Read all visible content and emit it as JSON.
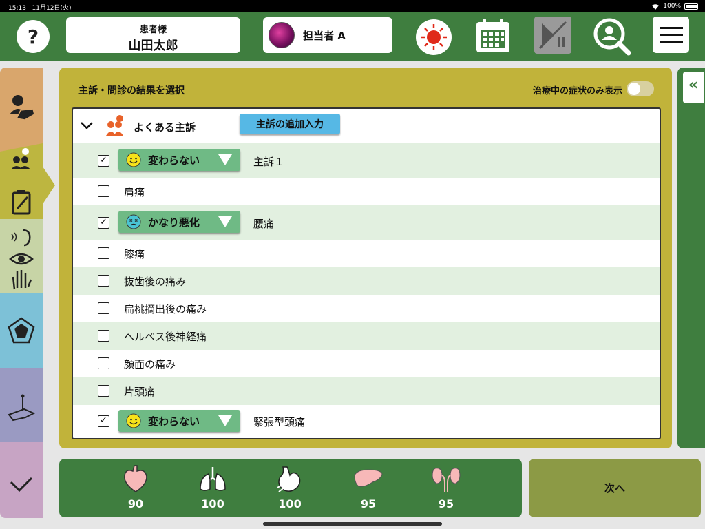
{
  "status_bar": {
    "time": "15:13",
    "date": "11月12日(火)",
    "battery": "100%"
  },
  "header": {
    "help_label": "?",
    "patient_label": "患者様",
    "patient_name": "山田太郎",
    "staff_name": "担当者 A"
  },
  "panel": {
    "title": "主訴・問診の結果を選択",
    "toggle_label": "治療中の症状のみ表示",
    "toggle_on": false,
    "section_title": "よくある主訴",
    "add_button": "主訴の追加入力"
  },
  "rows": [
    {
      "label": "主訴１",
      "checked": true,
      "status": "変わらない",
      "face": "smile-icon"
    },
    {
      "label": "肩痛",
      "checked": false
    },
    {
      "label": "腰痛",
      "checked": true,
      "status": "かなり悪化",
      "face": "dizzy-face-icon"
    },
    {
      "label": "膝痛",
      "checked": false
    },
    {
      "label": "抜歯後の痛み",
      "checked": false
    },
    {
      "label": "扁桃摘出後の痛み",
      "checked": false
    },
    {
      "label": "ヘルペス後神経痛",
      "checked": false
    },
    {
      "label": "顔面の痛み",
      "checked": false
    },
    {
      "label": "片頭痛",
      "checked": false
    },
    {
      "label": "緊張型頭痛",
      "checked": true,
      "status": "変わらない",
      "face": "smile-icon"
    }
  ],
  "right_tab_label": "«",
  "metrics": [
    {
      "icon": "heart-icon",
      "value": "90"
    },
    {
      "icon": "lungs-icon",
      "value": "100"
    },
    {
      "icon": "stomach-icon",
      "value": "100"
    },
    {
      "icon": "liver-icon",
      "value": "95"
    },
    {
      "icon": "kidneys-icon",
      "value": "95"
    }
  ],
  "next_button": "次へ",
  "colors": {
    "header_green": "#3f7e3f",
    "panel_olive": "#c1b33a",
    "row_alt": "#e2f0e0",
    "status_green": "#6fba85",
    "add_blue": "#56b8e5"
  }
}
